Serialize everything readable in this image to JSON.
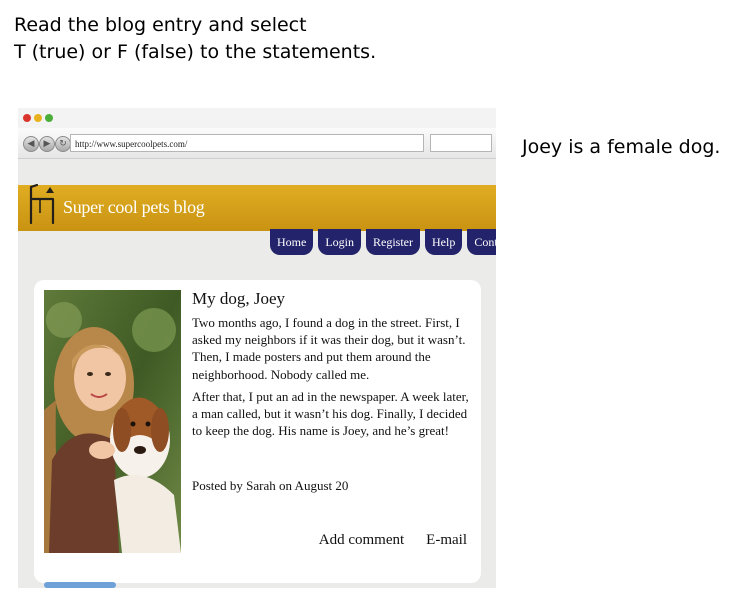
{
  "instructions": {
    "line1": "Read the blog entry and select",
    "line2": "T (true) or F (false) to the statements."
  },
  "statement": "Joey is a female dog.",
  "browser": {
    "url": "http://www.supercoolpets.com/",
    "traffic_lights": [
      "#d9352c",
      "#e8b21e",
      "#4cae3a"
    ],
    "nav_icons": [
      "back-arrow-icon",
      "forward-arrow-icon",
      "refresh-icon"
    ]
  },
  "site": {
    "title": "Super cool pets blog",
    "banner_color": "#d6a11a",
    "nav_color": "#23236b",
    "nav": [
      "Home",
      "Login",
      "Register",
      "Help",
      "Contact"
    ]
  },
  "post": {
    "title": "My dog, Joey",
    "body": [
      "Two months ago, I found a dog in the street. First, I asked my neighbors if it was their dog, but it wasn’t. Then, I made posters and put them around the neighborhood. Nobody called me.",
      "After that, I put an ad in the newspaper. A week later, a man called, but it wasn’t his dog. Finally, I decided to keep the dog. His name is Joey, and he’s great!"
    ],
    "posted_by": "Posted by Sarah on August 20",
    "add_comment": "Add comment",
    "email": "E-mail"
  }
}
